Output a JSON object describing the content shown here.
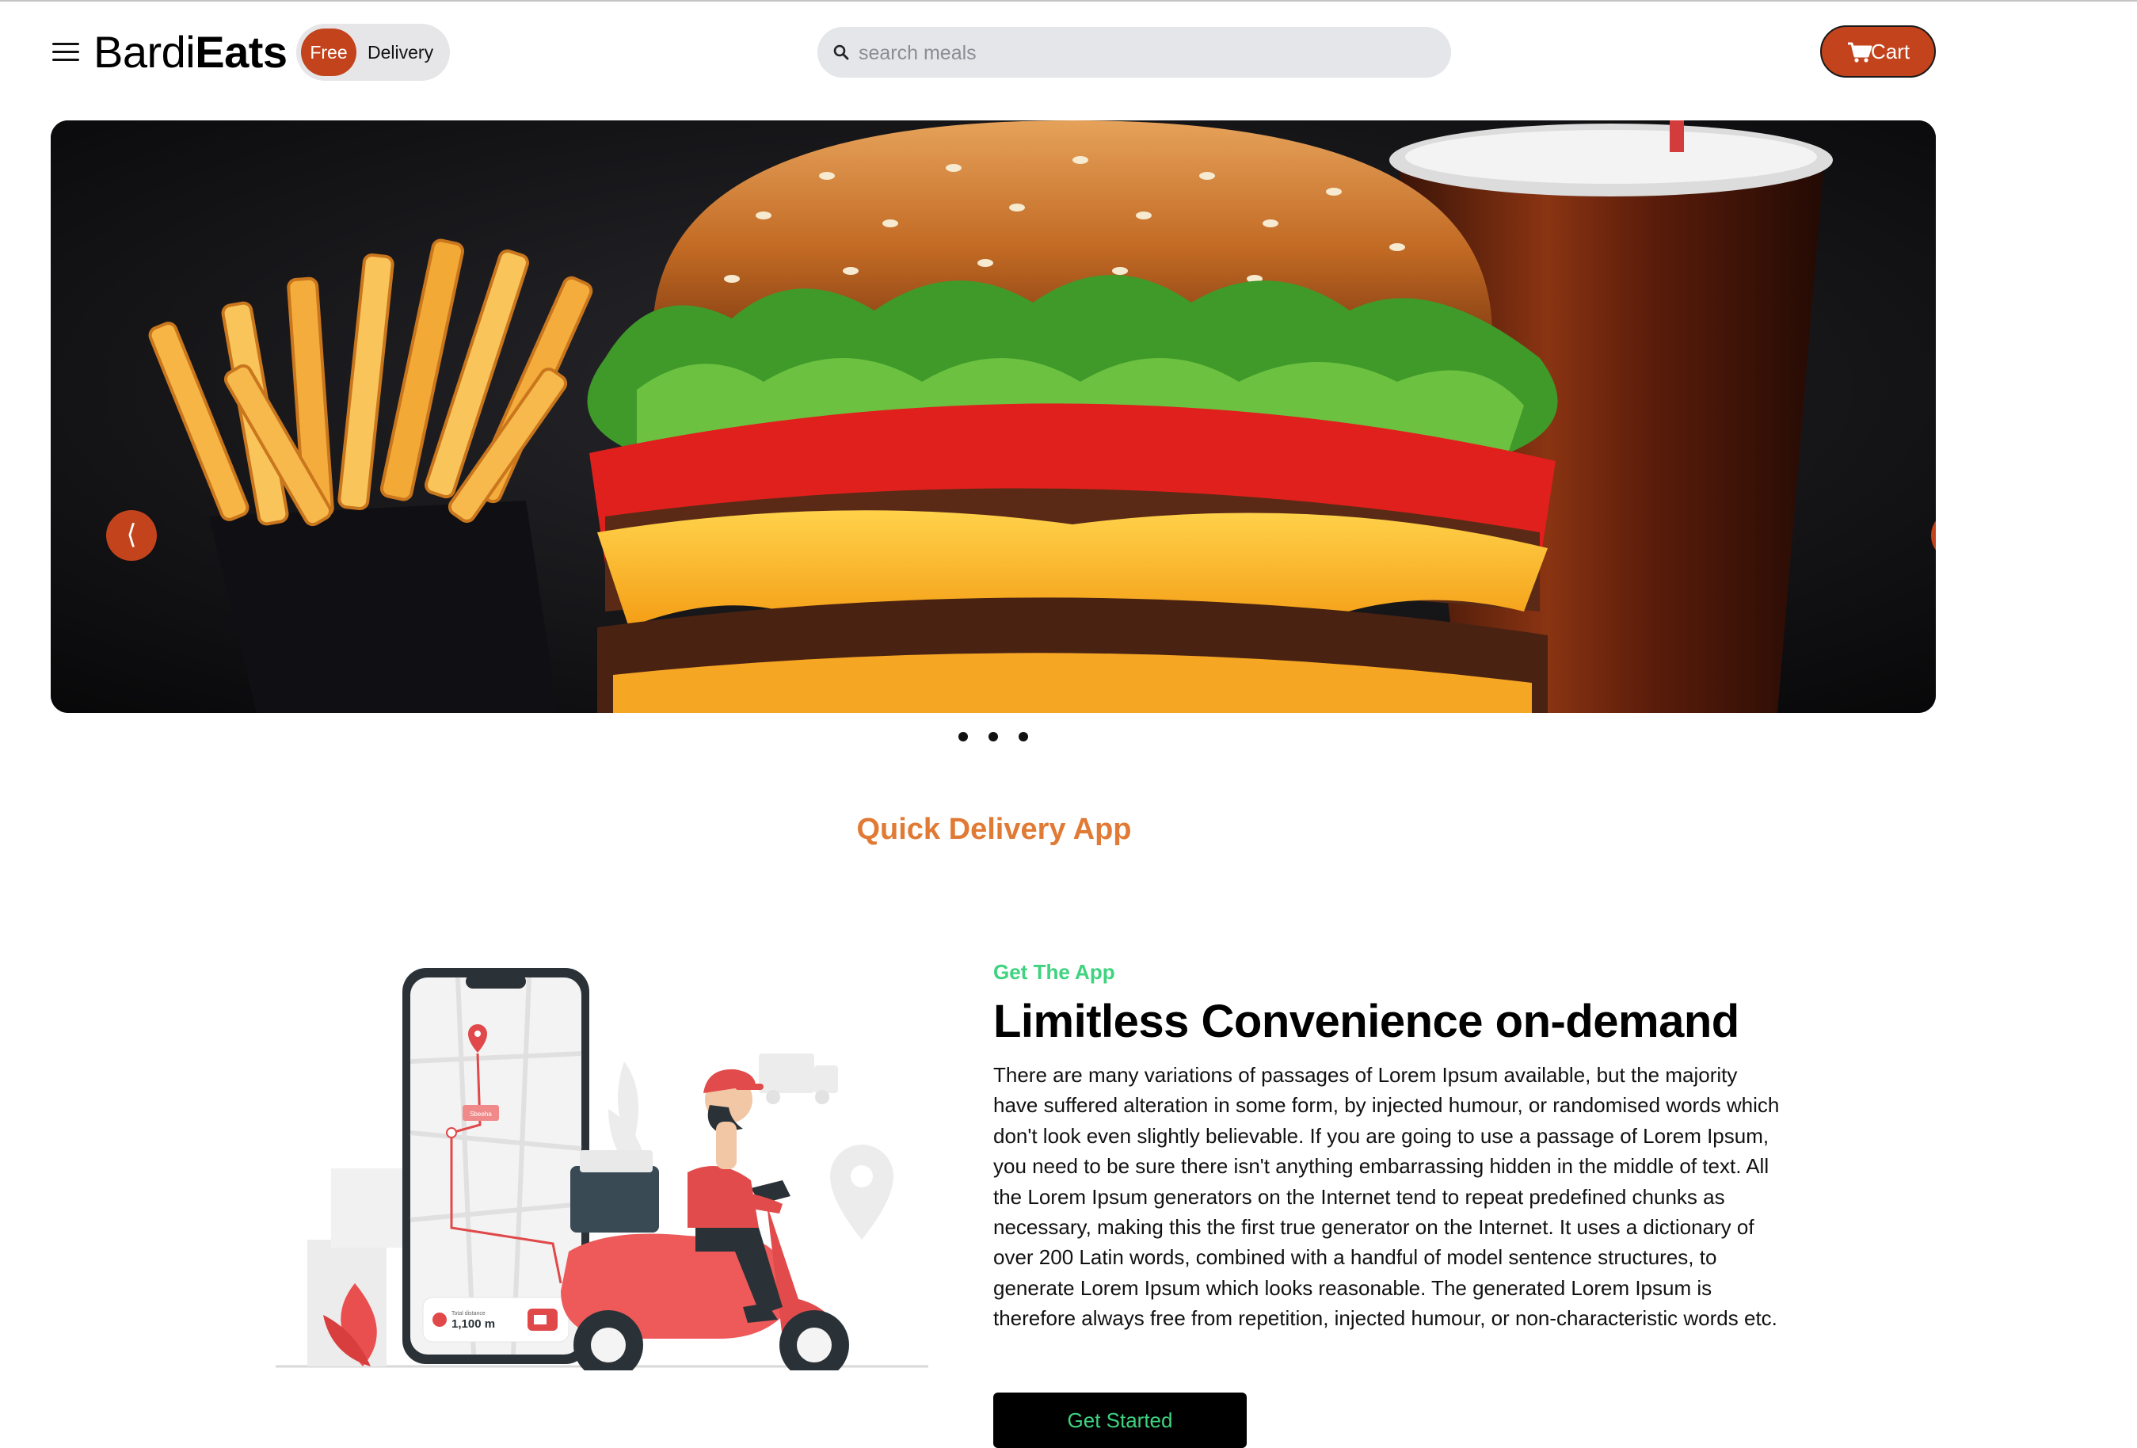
{
  "header": {
    "logo_regular": "Bardi",
    "logo_bold": "Eats",
    "toggle": {
      "active": "Free",
      "inactive": "Delivery"
    },
    "search": {
      "placeholder": "search meals",
      "value": ""
    },
    "cart_label": "Cart"
  },
  "carousel": {
    "prev_label": "⟨",
    "next_label": "⟩",
    "slide_count": 3,
    "hero_icons": [
      "fries-image",
      "burger-image",
      "soda-cup-image"
    ]
  },
  "section": {
    "title": "Quick Delivery App"
  },
  "promo": {
    "eyebrow": "Get The App",
    "heading": "Limitless Convenience on-demand",
    "body": "There are many variations of passages of Lorem Ipsum available, but the majority have suffered alteration in some form, by injected humour, or randomised words which don't look even slightly believable. If you are going to use a passage of Lorem Ipsum, you need to be sure there isn't anything embarrassing hidden in the middle of text. All the Lorem Ipsum generators on the Internet tend to repeat predefined chunks as necessary, making this the first true generator on the Internet. It uses a dictionary of over 200 Latin words, combined with a handful of model sentence structures, to generate Lorem Ipsum which looks reasonable. The generated Lorem Ipsum is therefore always free from repetition, injected humour, or non-characteristic words etc.",
    "cta_label": "Get Started",
    "illustration": {
      "map_tag": "Sbeeha",
      "distance_label": "Total distance",
      "distance_value": "1,100 m"
    }
  },
  "colors": {
    "accent": "#c2431c",
    "title_orange": "#e07a34",
    "green": "#3ed37f",
    "search_bg": "#e4e6ea"
  }
}
